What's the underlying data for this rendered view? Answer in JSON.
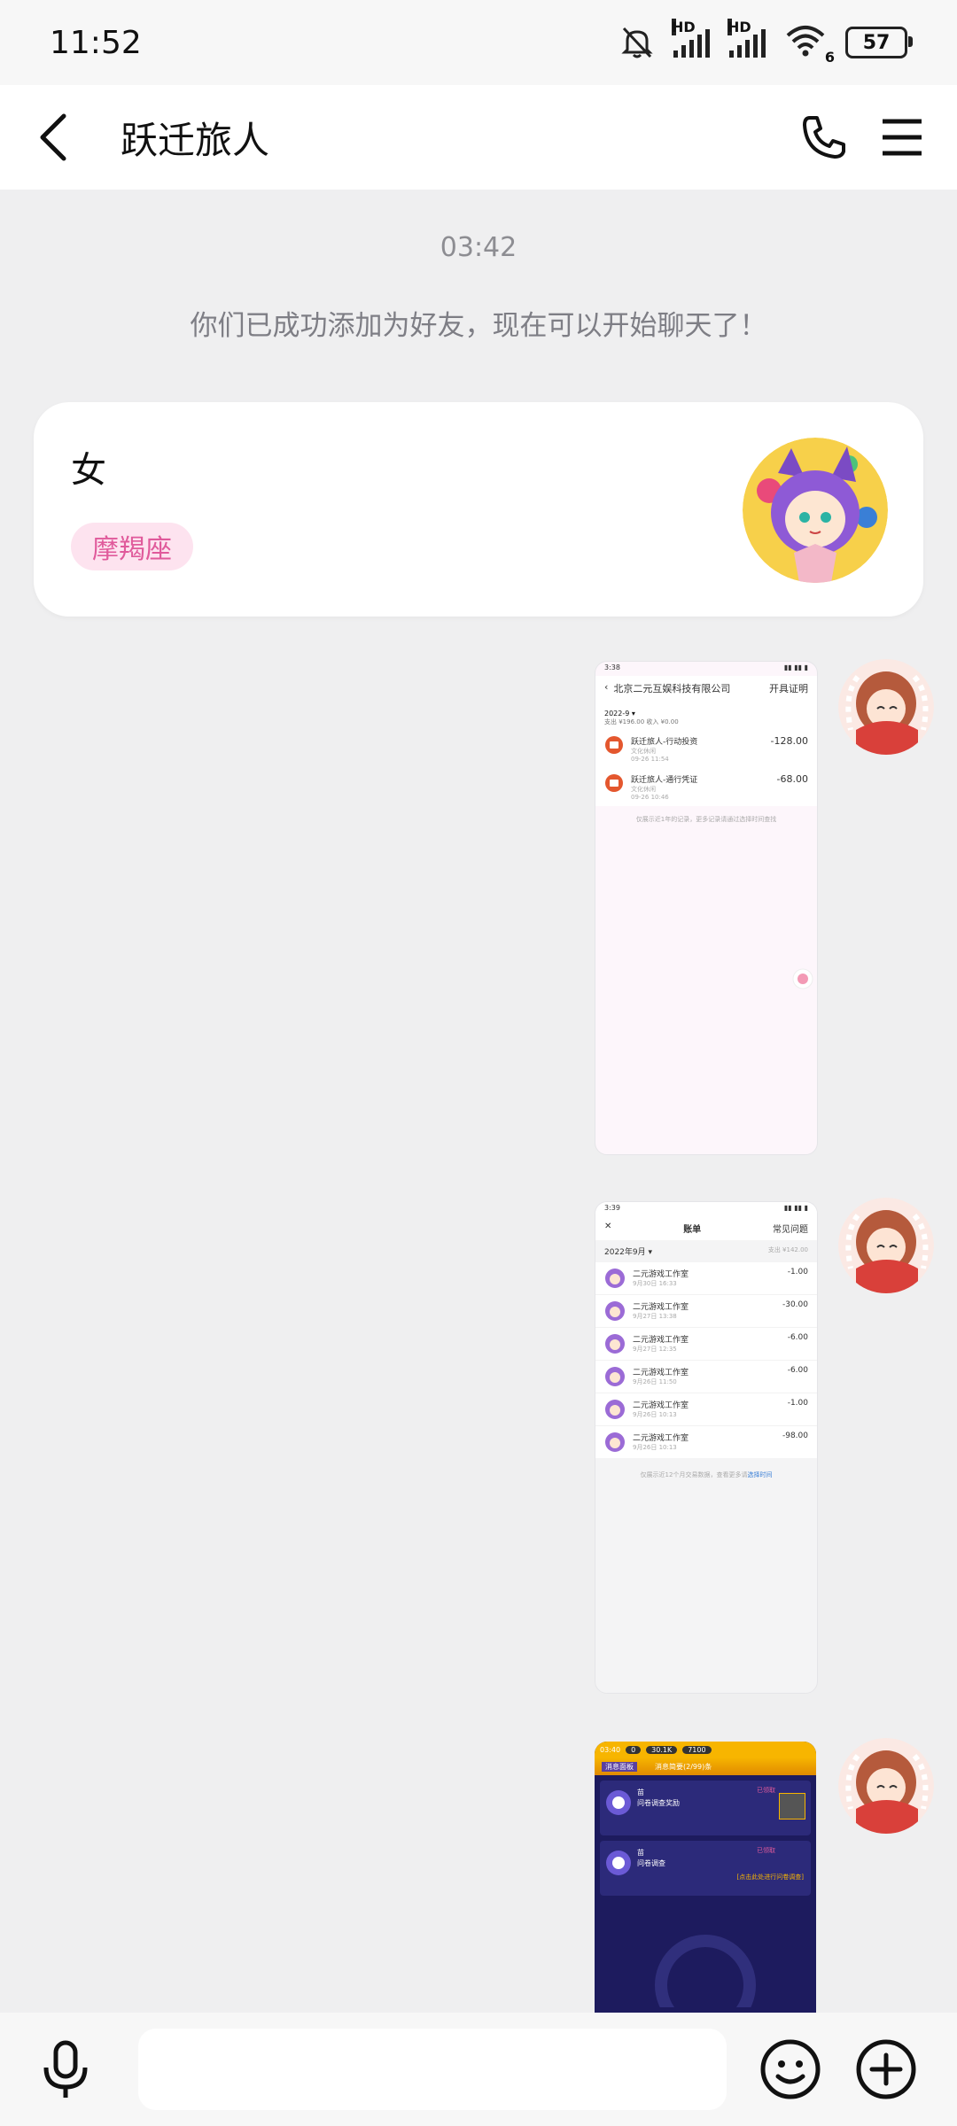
{
  "status_bar": {
    "time": "11:52",
    "signal1_label": "HD",
    "signal2_label": "HD",
    "wifi_label": "6",
    "battery": "57"
  },
  "header": {
    "title": "跃迁旅人",
    "back_icon": "chevron-left-icon",
    "call_icon": "phone-icon",
    "menu_icon": "menu-icon"
  },
  "chat": {
    "timestamp": "03:42",
    "system_message": "你们已成功添加为好友，现在可以开始聊天了！",
    "profile_card": {
      "gender": "女",
      "zodiac": "摩羯座"
    },
    "messages": [
      {
        "type": "image",
        "shot1": {
          "time": "3:38",
          "title": "北京二元互娱科技有限公司",
          "action": "开具证明",
          "month": "2022-9 ▾",
          "summary": "支出 ¥196.00   收入 ¥0.00",
          "items": [
            {
              "name": "跃迁旅人-行动投资",
              "cat": "文化休闲",
              "date": "09-26 11:54",
              "amount": "-128.00"
            },
            {
              "name": "跃迁旅人-通行凭证",
              "cat": "文化休闲",
              "date": "09-26 10:46",
              "amount": "-68.00"
            }
          ],
          "footer": "仅展示近1年的记录，更多记录请通过选择时间查找"
        }
      },
      {
        "type": "image",
        "shot2": {
          "time": "3:39",
          "title": "账单",
          "faq": "常见问题",
          "month": "2022年9月 ▾",
          "total": "支出 ¥142.00",
          "items": [
            {
              "name": "二元游戏工作室",
              "date": "9月30日 16:33",
              "amount": "-1.00"
            },
            {
              "name": "二元游戏工作室",
              "date": "9月27日 13:38",
              "amount": "-30.00"
            },
            {
              "name": "二元游戏工作室",
              "date": "9月27日 12:35",
              "amount": "-6.00"
            },
            {
              "name": "二元游戏工作室",
              "date": "9月26日 11:50",
              "amount": "-6.00"
            },
            {
              "name": "二元游戏工作室",
              "date": "9月26日 10:13",
              "amount": "-1.00"
            },
            {
              "name": "二元游戏工作室",
              "date": "9月26日 10:13",
              "amount": "-98.00"
            }
          ],
          "footer_text": "仅展示近12个月交易数据，查看更多请",
          "footer_link": "选择时间"
        }
      },
      {
        "type": "image",
        "shot3": {
          "time": "03:40",
          "res1": "0",
          "res2": "30.1K",
          "res3": "7100",
          "tab": "消息面板",
          "subtitle": "消息简要(2/99)条",
          "cards": [
            {
              "name": "苗",
              "sub": "问卷调查奖励",
              "tag": "已领取"
            },
            {
              "name": "苗",
              "sub": "问卷调查",
              "tag": "已领取",
              "hint": "[点击此处进行问卷调查]"
            }
          ]
        }
      }
    ]
  },
  "input_bar": {
    "placeholder": "",
    "mic_icon": "microphone-icon",
    "emoji_icon": "smiley-icon",
    "plus_icon": "plus-circle-icon"
  },
  "colors": {
    "background": "#efeff0",
    "zodiac_bg": "#fde3ef",
    "zodiac_text": "#e05a9b",
    "accent_orange": "#e4572e",
    "game_yellow": "#f7b500",
    "game_navy": "#1d1b5e"
  }
}
